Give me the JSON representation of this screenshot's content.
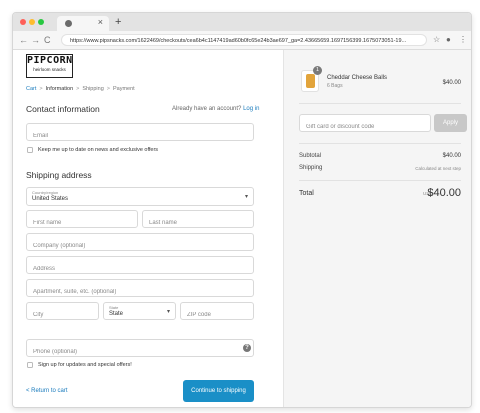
{
  "browser": {
    "url": "https://www.pipsnacks.com/1622469/checkouts/cea6b4c1147419ad60b0fc65e24b3ae697_ga=2.43665659.1697156399.1675073051-19...",
    "new_tab_symbol": "+",
    "tab_close_symbol": "×",
    "traffic_lights": [
      "#fe5f57",
      "#febc2e",
      "#28c840"
    ],
    "nav_icons": [
      "back-arrow-icon",
      "forward-arrow-icon",
      "reload-icon"
    ],
    "nav_glyphs": {
      "back": "←",
      "forward": "→",
      "reload": "C"
    },
    "right_glyphs": {
      "star": "☆",
      "profile": "●",
      "menu": "⋮"
    }
  },
  "store": {
    "logo_main": "PIPCORN",
    "logo_sub": "heirloom snacks"
  },
  "breadcrumb": {
    "items": [
      "Cart",
      "Information",
      "Shipping",
      "Payment"
    ],
    "separator": ">"
  },
  "contact": {
    "title": "Contact information",
    "have_account_text": "Already have an account?",
    "login_label": "Log in",
    "email_placeholder": "Email",
    "newsletter_label": "Keep me up to date on news and exclusive offers"
  },
  "shipping": {
    "title": "Shipping address",
    "country_label": "Country/region",
    "country_value": "United States",
    "first_name_placeholder": "First name",
    "last_name_placeholder": "Last name",
    "company_placeholder": "Company (optional)",
    "address_placeholder": "Address",
    "apartment_placeholder": "Apartment, suite, etc. (optional)",
    "city_placeholder": "City",
    "state_label": "State",
    "state_value": "State",
    "zip_placeholder": "ZIP code",
    "phone_placeholder": "Phone (optional)",
    "help_symbol": "?",
    "updates_label": "Sign up for updates and special offers!",
    "caret_symbol": "▾"
  },
  "actions": {
    "return_label": "< Return to cart",
    "continue_label": "Continue to shipping"
  },
  "summary": {
    "product_name": "Cheddar Cheese Balls",
    "product_variant": "6 Bags",
    "product_qty": "1",
    "product_price": "$40.00",
    "gift_placeholder": "Gift card or discount code",
    "apply_label": "Apply",
    "subtotal_label": "Subtotal",
    "subtotal_value": "$40.00",
    "shipping_label": "Shipping",
    "shipping_value": "Calculated at next step",
    "total_label": "Total",
    "total_currency": "USD",
    "total_value": "$40.00"
  },
  "colors": {
    "accent": "#1a8fc7",
    "link": "#197bbd",
    "sidebar_bg": "#f5f5f5"
  }
}
